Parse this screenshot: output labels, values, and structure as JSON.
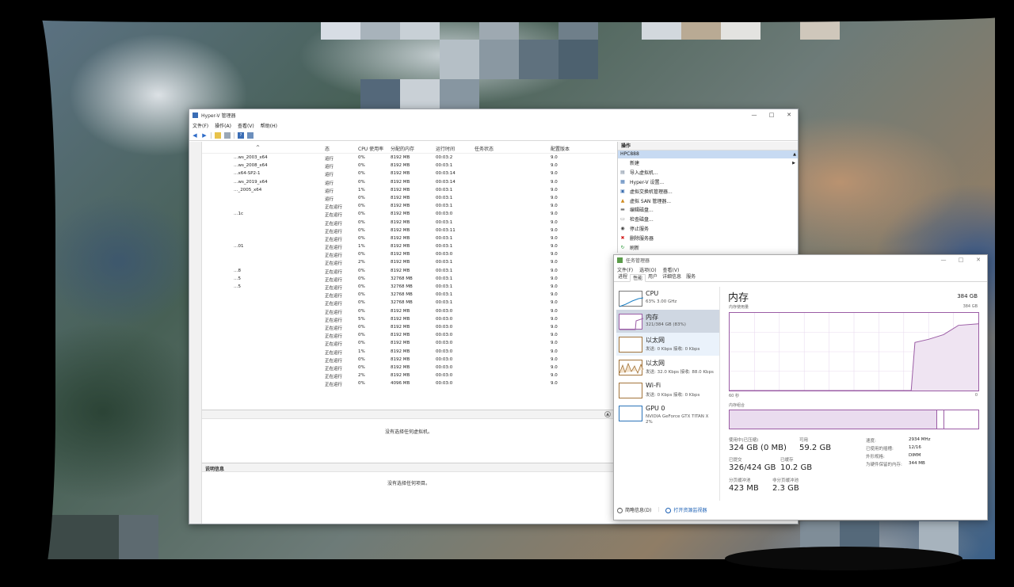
{
  "hyperv": {
    "title": "Hyper-V 管理器",
    "menu": [
      "文件(F)",
      "操作(A)",
      "查看(V)",
      "帮助(H)"
    ],
    "columns": {
      "state": "态",
      "cpu": "CPU 使用率",
      "memory": "分配的内存",
      "uptime": "运行时间",
      "status": "任务状态",
      "version": "配置版本"
    },
    "vms": [
      {
        "name": "…ws_2003_x64",
        "state": "运行",
        "cpu": "0%",
        "memory": "8192 MB",
        "uptime": "00:03:2",
        "version": "9.0"
      },
      {
        "name": "…ws_2008_x64",
        "state": "运行",
        "cpu": "0%",
        "memory": "8192 MB",
        "uptime": "00:03:1",
        "version": "9.0"
      },
      {
        "name": "…x64-SP2-1",
        "state": "运行",
        "cpu": "0%",
        "memory": "8192 MB",
        "uptime": "00:03:14",
        "version": "9.0"
      },
      {
        "name": "…ws_2019_x64",
        "state": "运行",
        "cpu": "0%",
        "memory": "8192 MB",
        "uptime": "00:03:14",
        "version": "9.0"
      },
      {
        "name": "…_2005_x64",
        "state": "运行",
        "cpu": "1%",
        "memory": "8192 MB",
        "uptime": "00:03:1",
        "version": "9.0"
      },
      {
        "name": "",
        "state": "运行",
        "cpu": "0%",
        "memory": "8192 MB",
        "uptime": "00:03:1",
        "version": "9.0"
      },
      {
        "name": "",
        "state": "正在运行",
        "cpu": "0%",
        "memory": "8192 MB",
        "uptime": "00:03:1",
        "version": "9.0"
      },
      {
        "name": "…1c",
        "state": "正在运行",
        "cpu": "0%",
        "memory": "8192 MB",
        "uptime": "00:03:0",
        "version": "9.0"
      },
      {
        "name": "",
        "state": "正在运行",
        "cpu": "0%",
        "memory": "8192 MB",
        "uptime": "00:03:1",
        "version": "9.0"
      },
      {
        "name": "",
        "state": "正在运行",
        "cpu": "0%",
        "memory": "8192 MB",
        "uptime": "00:03:11",
        "version": "9.0"
      },
      {
        "name": "",
        "state": "正在运行",
        "cpu": "0%",
        "memory": "8192 MB",
        "uptime": "00:03:1",
        "version": "9.0"
      },
      {
        "name": "…01",
        "state": "正在运行",
        "cpu": "1%",
        "memory": "8192 MB",
        "uptime": "00:03:1",
        "version": "9.0"
      },
      {
        "name": "",
        "state": "正在运行",
        "cpu": "0%",
        "memory": "8192 MB",
        "uptime": "00:03:0",
        "version": "9.0"
      },
      {
        "name": "",
        "state": "正在运行",
        "cpu": "2%",
        "memory": "8192 MB",
        "uptime": "00:03:1",
        "version": "9.0"
      },
      {
        "name": "…8",
        "state": "正在运行",
        "cpu": "0%",
        "memory": "8192 MB",
        "uptime": "00:03:1",
        "version": "9.0"
      },
      {
        "name": "…5",
        "state": "正在运行",
        "cpu": "0%",
        "memory": "32768 MB",
        "uptime": "00:03:1",
        "version": "9.0"
      },
      {
        "name": "…5",
        "state": "正在运行",
        "cpu": "0%",
        "memory": "32768 MB",
        "uptime": "00:03:1",
        "version": "9.0"
      },
      {
        "name": "",
        "state": "正在运行",
        "cpu": "0%",
        "memory": "32768 MB",
        "uptime": "00:03:1",
        "version": "9.0"
      },
      {
        "name": "",
        "state": "正在运行",
        "cpu": "0%",
        "memory": "32768 MB",
        "uptime": "00:03:1",
        "version": "9.0"
      },
      {
        "name": "",
        "state": "正在运行",
        "cpu": "0%",
        "memory": "8192 MB",
        "uptime": "00:03:0",
        "version": "9.0"
      },
      {
        "name": "",
        "state": "正在运行",
        "cpu": "5%",
        "memory": "8192 MB",
        "uptime": "00:03:0",
        "version": "9.0"
      },
      {
        "name": "",
        "state": "正在运行",
        "cpu": "0%",
        "memory": "8192 MB",
        "uptime": "00:03:0",
        "version": "9.0"
      },
      {
        "name": "",
        "state": "正在运行",
        "cpu": "0%",
        "memory": "8192 MB",
        "uptime": "00:03:0",
        "version": "9.0"
      },
      {
        "name": "",
        "state": "正在运行",
        "cpu": "0%",
        "memory": "8192 MB",
        "uptime": "00:03:0",
        "version": "9.0"
      },
      {
        "name": "",
        "state": "正在运行",
        "cpu": "1%",
        "memory": "8192 MB",
        "uptime": "00:03:0",
        "version": "9.0"
      },
      {
        "name": "",
        "state": "正在运行",
        "cpu": "0%",
        "memory": "8192 MB",
        "uptime": "00:03:0",
        "version": "9.0"
      },
      {
        "name": "",
        "state": "正在运行",
        "cpu": "0%",
        "memory": "8192 MB",
        "uptime": "00:03:0",
        "version": "9.0"
      },
      {
        "name": "",
        "state": "正在运行",
        "cpu": "2%",
        "memory": "8192 MB",
        "uptime": "00:03:0",
        "version": "9.0"
      },
      {
        "name": "",
        "state": "正在运行",
        "cpu": "0%",
        "memory": "4096 MB",
        "uptime": "00:03:0",
        "version": "9.0"
      }
    ],
    "checkpoints_msg": "没有选择任何虚拟机。",
    "details_title": "说明信息",
    "details_msg": "没有选择任何项目。",
    "actions_title": "操作",
    "host": "HPC888",
    "actions": [
      {
        "icon": "new-icon",
        "label": "新建",
        "submenu": true
      },
      {
        "icon": "import-icon",
        "label": "导入虚拟机..."
      },
      {
        "icon": "settings-icon",
        "label": "Hyper-V 设置..."
      },
      {
        "icon": "switch-manager-icon",
        "label": "虚拟交换机管理器..."
      },
      {
        "icon": "san-manager-icon",
        "label": "虚拟 SAN 管理器..."
      },
      {
        "icon": "edit-disk-icon",
        "label": "编辑磁盘..."
      },
      {
        "icon": "inspect-disk-icon",
        "label": "检查磁盘..."
      },
      {
        "icon": "stop-icon",
        "label": "停止服务"
      },
      {
        "icon": "remove-server-icon",
        "label": "删除服务器"
      },
      {
        "icon": "refresh-icon",
        "label": "刷新"
      }
    ]
  },
  "taskmgr": {
    "title": "任务管理器",
    "menu": [
      "文件(F)",
      "选项(O)",
      "查看(V)"
    ],
    "tabs": [
      "进程",
      "性能",
      "用户",
      "详细信息",
      "服务"
    ],
    "active_tab": "性能",
    "resources": [
      {
        "name": "CPU",
        "sub": "63% 3.00 GHz",
        "sub2": ""
      },
      {
        "name": "内存",
        "sub": "321/384 GB (83%)",
        "sub2": ""
      },
      {
        "name": "以太网",
        "sub": "发送: 0 Kbps 接收: 0 Kbps",
        "sub2": ""
      },
      {
        "name": "以太网",
        "sub": "发送: 32.0 Kbps 接收: 88.0 Kbps",
        "sub2": ""
      },
      {
        "name": "Wi-Fi",
        "sub": "发送: 0 Kbps 接收: 0 Kbps",
        "sub2": ""
      },
      {
        "name": "GPU 0",
        "sub": "NVIDIA GeForce GTX TITAN X",
        "sub2": "2%"
      }
    ],
    "memory": {
      "title": "内存",
      "total": "384 GB",
      "usage_label": "内存使用量",
      "max_label": "384 GB",
      "time_left": "60 秒",
      "time_right": "0",
      "composition_label": "内存组合",
      "in_use_fraction": 0.83,
      "modified_fraction": 0.03,
      "graph_points": [
        [
          0,
          0
        ],
        [
          0.73,
          0
        ],
        [
          0.745,
          0.62
        ],
        [
          0.8,
          0.66
        ],
        [
          0.86,
          0.72
        ],
        [
          0.92,
          0.84
        ],
        [
          1,
          0.86
        ]
      ],
      "stats": {
        "in_use_label": "使用中(已压缩)",
        "in_use": "324 GB (0 MB)",
        "available_label": "可用",
        "available": "59.2 GB",
        "committed_label": "已提交",
        "committed": "326/424 GB",
        "cached_label": "已缓存",
        "cached": "10.2 GB",
        "paged_label": "分页缓冲池",
        "paged": "423 MB",
        "nonpaged_label": "非分页缓冲池",
        "nonpaged": "2.3 GB"
      },
      "hw": [
        {
          "k": "速度:",
          "v": "2934 MHz"
        },
        {
          "k": "已使用的插槽:",
          "v": "12/16"
        },
        {
          "k": "外形规格:",
          "v": "DIMM"
        },
        {
          "k": "为硬件保留的内存:",
          "v": "344 MB"
        }
      ]
    },
    "fewer_details": "简略信息(D)",
    "open_resmon": "打开资源监视器",
    "colors": {
      "graph": "#9b5ca5",
      "graph_fill": "#efe4f2"
    }
  }
}
